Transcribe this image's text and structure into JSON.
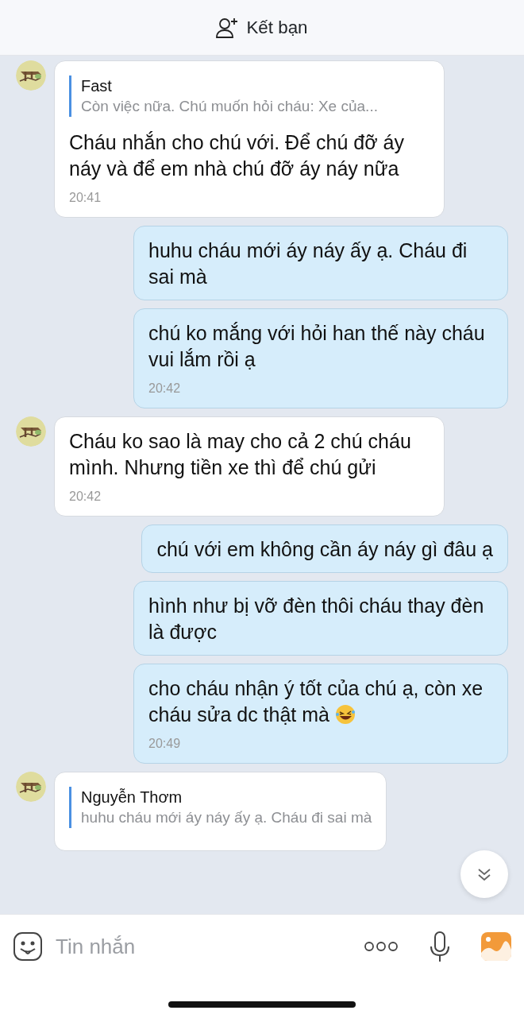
{
  "header": {
    "action": "Kết bạn"
  },
  "messages": [
    {
      "kind": "incoming",
      "quote": {
        "name": "Fast",
        "text": "Còn việc nữa. Chú muốn hỏi cháu: Xe của..."
      },
      "text": "Cháu nhắn cho chú với. Để chú đỡ áy náy và để em nhà chú đỡ áy náy nữa",
      "time": "20:41"
    },
    {
      "kind": "outgoing",
      "text": "huhu cháu mới áy náy ấy ạ. Cháu đi sai mà"
    },
    {
      "kind": "outgoing",
      "text": "chú ko mắng với hỏi han thế này cháu vui lắm rồi ạ",
      "time": "20:42"
    },
    {
      "kind": "incoming",
      "text": "Cháu ko sao là may cho cả 2 chú cháu mình. Nhưng tiền xe thì để chú gửi",
      "time": "20:42"
    },
    {
      "kind": "outgoing",
      "text": "chú với em không cần áy náy gì đâu ạ"
    },
    {
      "kind": "outgoing",
      "text": "hình như bị vỡ đèn thôi cháu thay đèn là được"
    },
    {
      "kind": "outgoing",
      "text": "cho cháu nhận ý tốt của chú ạ, còn xe cháu sửa dc thật mà",
      "emoji": true,
      "time": "20:49"
    },
    {
      "kind": "incoming",
      "quote": {
        "name": "Nguyễn Thơm",
        "text": "huhu cháu mới áy náy ấy ạ. Cháu đi sai mà"
      }
    }
  ],
  "composer": {
    "placeholder": "Tin nhắn"
  }
}
